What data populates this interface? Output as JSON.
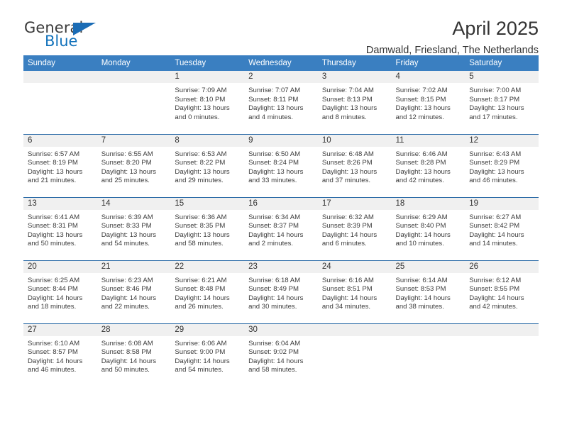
{
  "logo": {
    "word_top": "General",
    "word_bottom": "Blue",
    "accent_color": "#1b6cb5",
    "text_color": "#3a3a3a"
  },
  "header": {
    "title": "April 2025",
    "subtitle": "Damwald, Friesland, The Netherlands"
  },
  "theme": {
    "header_blue": "#3a7fc1",
    "rule_blue": "#2e6da8",
    "daynum_band": "#f0f0f0"
  },
  "weekday_headers": [
    "Sunday",
    "Monday",
    "Tuesday",
    "Wednesday",
    "Thursday",
    "Friday",
    "Saturday"
  ],
  "weeks": [
    [
      {
        "day": "",
        "lines": []
      },
      {
        "day": "",
        "lines": []
      },
      {
        "day": "1",
        "lines": [
          "Sunrise: 7:09 AM",
          "Sunset: 8:10 PM",
          "Daylight: 13 hours",
          "and 0 minutes."
        ]
      },
      {
        "day": "2",
        "lines": [
          "Sunrise: 7:07 AM",
          "Sunset: 8:11 PM",
          "Daylight: 13 hours",
          "and 4 minutes."
        ]
      },
      {
        "day": "3",
        "lines": [
          "Sunrise: 7:04 AM",
          "Sunset: 8:13 PM",
          "Daylight: 13 hours",
          "and 8 minutes."
        ]
      },
      {
        "day": "4",
        "lines": [
          "Sunrise: 7:02 AM",
          "Sunset: 8:15 PM",
          "Daylight: 13 hours",
          "and 12 minutes."
        ]
      },
      {
        "day": "5",
        "lines": [
          "Sunrise: 7:00 AM",
          "Sunset: 8:17 PM",
          "Daylight: 13 hours",
          "and 17 minutes."
        ]
      }
    ],
    [
      {
        "day": "6",
        "lines": [
          "Sunrise: 6:57 AM",
          "Sunset: 8:19 PM",
          "Daylight: 13 hours",
          "and 21 minutes."
        ]
      },
      {
        "day": "7",
        "lines": [
          "Sunrise: 6:55 AM",
          "Sunset: 8:20 PM",
          "Daylight: 13 hours",
          "and 25 minutes."
        ]
      },
      {
        "day": "8",
        "lines": [
          "Sunrise: 6:53 AM",
          "Sunset: 8:22 PM",
          "Daylight: 13 hours",
          "and 29 minutes."
        ]
      },
      {
        "day": "9",
        "lines": [
          "Sunrise: 6:50 AM",
          "Sunset: 8:24 PM",
          "Daylight: 13 hours",
          "and 33 minutes."
        ]
      },
      {
        "day": "10",
        "lines": [
          "Sunrise: 6:48 AM",
          "Sunset: 8:26 PM",
          "Daylight: 13 hours",
          "and 37 minutes."
        ]
      },
      {
        "day": "11",
        "lines": [
          "Sunrise: 6:46 AM",
          "Sunset: 8:28 PM",
          "Daylight: 13 hours",
          "and 42 minutes."
        ]
      },
      {
        "day": "12",
        "lines": [
          "Sunrise: 6:43 AM",
          "Sunset: 8:29 PM",
          "Daylight: 13 hours",
          "and 46 minutes."
        ]
      }
    ],
    [
      {
        "day": "13",
        "lines": [
          "Sunrise: 6:41 AM",
          "Sunset: 8:31 PM",
          "Daylight: 13 hours",
          "and 50 minutes."
        ]
      },
      {
        "day": "14",
        "lines": [
          "Sunrise: 6:39 AM",
          "Sunset: 8:33 PM",
          "Daylight: 13 hours",
          "and 54 minutes."
        ]
      },
      {
        "day": "15",
        "lines": [
          "Sunrise: 6:36 AM",
          "Sunset: 8:35 PM",
          "Daylight: 13 hours",
          "and 58 minutes."
        ]
      },
      {
        "day": "16",
        "lines": [
          "Sunrise: 6:34 AM",
          "Sunset: 8:37 PM",
          "Daylight: 14 hours",
          "and 2 minutes."
        ]
      },
      {
        "day": "17",
        "lines": [
          "Sunrise: 6:32 AM",
          "Sunset: 8:39 PM",
          "Daylight: 14 hours",
          "and 6 minutes."
        ]
      },
      {
        "day": "18",
        "lines": [
          "Sunrise: 6:29 AM",
          "Sunset: 8:40 PM",
          "Daylight: 14 hours",
          "and 10 minutes."
        ]
      },
      {
        "day": "19",
        "lines": [
          "Sunrise: 6:27 AM",
          "Sunset: 8:42 PM",
          "Daylight: 14 hours",
          "and 14 minutes."
        ]
      }
    ],
    [
      {
        "day": "20",
        "lines": [
          "Sunrise: 6:25 AM",
          "Sunset: 8:44 PM",
          "Daylight: 14 hours",
          "and 18 minutes."
        ]
      },
      {
        "day": "21",
        "lines": [
          "Sunrise: 6:23 AM",
          "Sunset: 8:46 PM",
          "Daylight: 14 hours",
          "and 22 minutes."
        ]
      },
      {
        "day": "22",
        "lines": [
          "Sunrise: 6:21 AM",
          "Sunset: 8:48 PM",
          "Daylight: 14 hours",
          "and 26 minutes."
        ]
      },
      {
        "day": "23",
        "lines": [
          "Sunrise: 6:18 AM",
          "Sunset: 8:49 PM",
          "Daylight: 14 hours",
          "and 30 minutes."
        ]
      },
      {
        "day": "24",
        "lines": [
          "Sunrise: 6:16 AM",
          "Sunset: 8:51 PM",
          "Daylight: 14 hours",
          "and 34 minutes."
        ]
      },
      {
        "day": "25",
        "lines": [
          "Sunrise: 6:14 AM",
          "Sunset: 8:53 PM",
          "Daylight: 14 hours",
          "and 38 minutes."
        ]
      },
      {
        "day": "26",
        "lines": [
          "Sunrise: 6:12 AM",
          "Sunset: 8:55 PM",
          "Daylight: 14 hours",
          "and 42 minutes."
        ]
      }
    ],
    [
      {
        "day": "27",
        "lines": [
          "Sunrise: 6:10 AM",
          "Sunset: 8:57 PM",
          "Daylight: 14 hours",
          "and 46 minutes."
        ]
      },
      {
        "day": "28",
        "lines": [
          "Sunrise: 6:08 AM",
          "Sunset: 8:58 PM",
          "Daylight: 14 hours",
          "and 50 minutes."
        ]
      },
      {
        "day": "29",
        "lines": [
          "Sunrise: 6:06 AM",
          "Sunset: 9:00 PM",
          "Daylight: 14 hours",
          "and 54 minutes."
        ]
      },
      {
        "day": "30",
        "lines": [
          "Sunrise: 6:04 AM",
          "Sunset: 9:02 PM",
          "Daylight: 14 hours",
          "and 58 minutes."
        ]
      },
      {
        "day": "",
        "lines": []
      },
      {
        "day": "",
        "lines": []
      },
      {
        "day": "",
        "lines": []
      }
    ]
  ]
}
